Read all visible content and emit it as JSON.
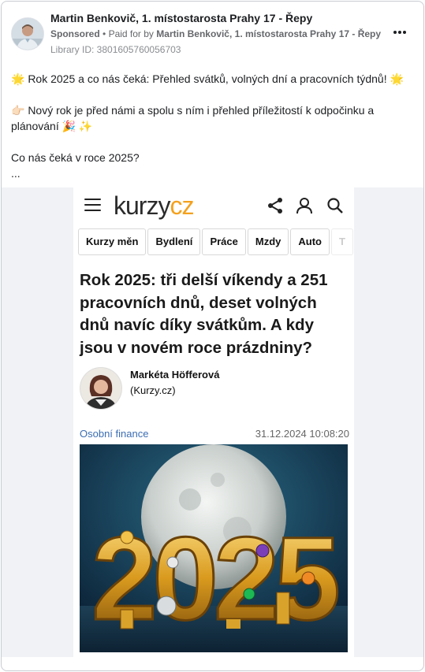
{
  "post": {
    "page_name": "Martin Benkovič, 1. místostarosta Prahy 17 - Řepy",
    "sponsored_label": "Sponsored",
    "paid_for_prefix": "Paid for by",
    "paid_for_by": "Martin Benkovič, 1. místostarosta Prahy 17 - Řepy",
    "library_id": "Library ID: 3801605760056703",
    "text_lines": [
      "🌟 Rok 2025 a co nás čeká: Přehled svátků, volných dní a pracovních týdnů! 🌟",
      "👉🏻 Nový rok je před námi a spolu s ním i přehled příležitostí k odpočinku a plánování 🎉 ✨",
      "Co nás čeká v roce 2025?",
      "..."
    ]
  },
  "article": {
    "logo_part1": "kurzy",
    "logo_part2": "cz",
    "tabs": [
      "Kurzy měn",
      "Bydlení",
      "Práce",
      "Mzdy",
      "Auto",
      "T"
    ],
    "headline": "Rok 2025: tři delší víkendy a 251 pracovních dnů, deset volných dnů navíc díky svátkům. A kdy jsou v novém roce prázdniny?",
    "author_name": "Markéta Höfferová",
    "author_source": "(Kurzy.cz)",
    "category": "Osobní finance",
    "date": "31.12.2024 10:08:20",
    "hero_text": "2025"
  },
  "colors": {
    "brand_orange": "#f4a11d",
    "link_blue": "#3b6db3",
    "meta_gray": "#65676b"
  },
  "icons": [
    "more-dots-icon",
    "hamburger-menu-icon",
    "share-icon",
    "user-icon",
    "search-icon"
  ]
}
